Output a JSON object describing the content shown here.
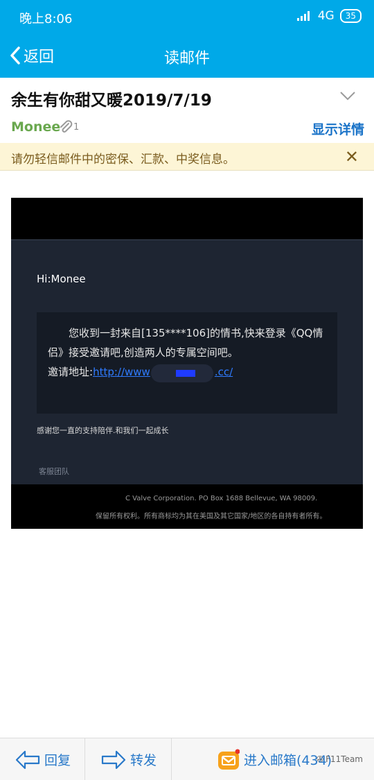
{
  "status_bar": {
    "time": "晚上8:06",
    "network": "4G",
    "battery": "35"
  },
  "nav": {
    "back_label": "返回",
    "title": "读邮件"
  },
  "mail": {
    "subject": "余生有你甜又暖2019/7/19",
    "sender": "Monee",
    "attachment_count": "1",
    "details_label": "显示详情"
  },
  "warning": {
    "text": "请勿轻信邮件中的密保、汇款、中奖信息。"
  },
  "email_image": {
    "greeting": "Hi:Monee",
    "body": "您收到一封来自[135****106]的情书,快来登录《QQ情侣》接受邀请吧,创造两人的专属空间吧。",
    "link_label": "邀请地址:",
    "link_start": "http://www",
    "link_end": ".cc/",
    "thanks": "感谢您一直的支持陪伴.和我们一起成长",
    "team": "客服团队",
    "footer_address": "C Valve Corporation. PO Box 1688 Bellevue, WA 98009.",
    "footer_rights": "保留所有权利。所有商标均为其在美国及其它国家/地区的各自持有者所有。"
  },
  "bottom_bar": {
    "reply_label": "回复",
    "forward_label": "转发",
    "inbox_label": "进入邮箱(434)"
  },
  "watermark": "F11Team",
  "colors": {
    "header": "#00a9e8",
    "sender": "#6aa84f",
    "link": "#1a73c8",
    "warning_bg": "#fdf5d6"
  }
}
